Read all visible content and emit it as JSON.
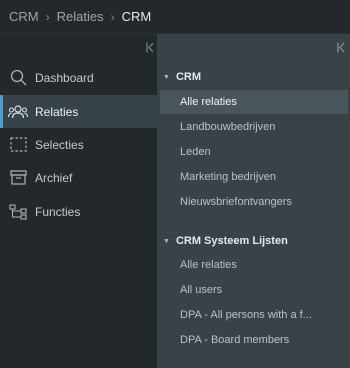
{
  "breadcrumb": {
    "items": [
      "CRM",
      "Relaties"
    ],
    "current": "CRM",
    "separator": "›"
  },
  "nav": {
    "items": [
      {
        "label": "Dashboard",
        "icon": "search-icon"
      },
      {
        "label": "Relaties",
        "icon": "people-icon"
      },
      {
        "label": "Selecties",
        "icon": "dashed-square-icon"
      },
      {
        "label": "Archief",
        "icon": "archive-box-icon"
      },
      {
        "label": "Functies",
        "icon": "hierarchy-icon"
      }
    ],
    "active": "Relaties"
  },
  "groups": [
    {
      "title": "CRM",
      "items": [
        "Alle relaties",
        "Landbouwbedrijven",
        "Leden",
        "Marketing bedrijven",
        "Nieuwsbriefontvangers"
      ],
      "selected": "Alle relaties"
    },
    {
      "title": "CRM Systeem Lijsten",
      "items": [
        "Alle relaties",
        "All users",
        "DPA - All persons with a f...",
        "DPA - Board members"
      ]
    }
  ],
  "colors": {
    "accent": "#4a9bd6",
    "sidebar_bg": "#22282c",
    "panel_bg": "#394247",
    "active_item_bg": "#364148",
    "selected_row_bg": "#4a555b"
  }
}
